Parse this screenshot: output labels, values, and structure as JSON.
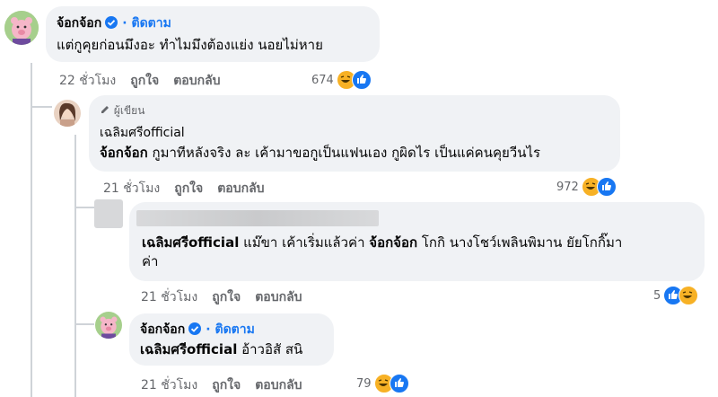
{
  "comments": [
    {
      "author": "จ้อกจ้อก",
      "follow_label": "· ติดตาม",
      "text": "แต่กูคุยก่อนมึงอะ ทำไมมึงต้องแย่ง นอยไม่หาย",
      "time": "22 ชั่วโมง",
      "like": "ถูกใจ",
      "reply": "ตอบกลับ",
      "reactions": "674"
    },
    {
      "badge": "ผู้เขียน",
      "author": "เฉลิมศรีofficial",
      "mention": "จ้อกจ้อก",
      "text": " กูมาทีหลังจริง ละ เค้ามาขอกูเป็นแฟนเอง กูผิดไร เป็นแค่คนคุยวีนไร",
      "time": "21 ชั่วโมง",
      "like": "ถูกใจ",
      "reply": "ตอบกลับ",
      "reactions": "972"
    },
    {
      "mention1": "เฉลิมศรีofficial",
      "text1": " แม๊ขา เค้าเริ่มแล้วค่า ",
      "mention2": "จ้อกจ้อก",
      "text2": " โกกิ นางโชว์เพลินพิมาน ยัยโกกิ๊มา",
      "text3": "ค่า",
      "time": "21 ชั่วโมง",
      "like": "ถูกใจ",
      "reply": "ตอบกลับ",
      "reactions": "5"
    },
    {
      "author": "จ้อกจ้อก",
      "follow_label": "· ติดตาม",
      "mention": "เฉลิมศรีofficial",
      "text": " อ้าวอิสั สนิ",
      "time": "21 ชั่วโมง",
      "like": "ถูกใจ",
      "reply": "ตอบกลับ",
      "reactions": "79"
    }
  ],
  "icons": {
    "verified": "verified-badge-icon",
    "author_badge": "pencil-icon",
    "haha": "haha-reaction-icon",
    "like": "like-reaction-icon"
  },
  "colors": {
    "link": "#1877f2",
    "bubble": "#f0f2f5",
    "meta": "#65676b"
  }
}
